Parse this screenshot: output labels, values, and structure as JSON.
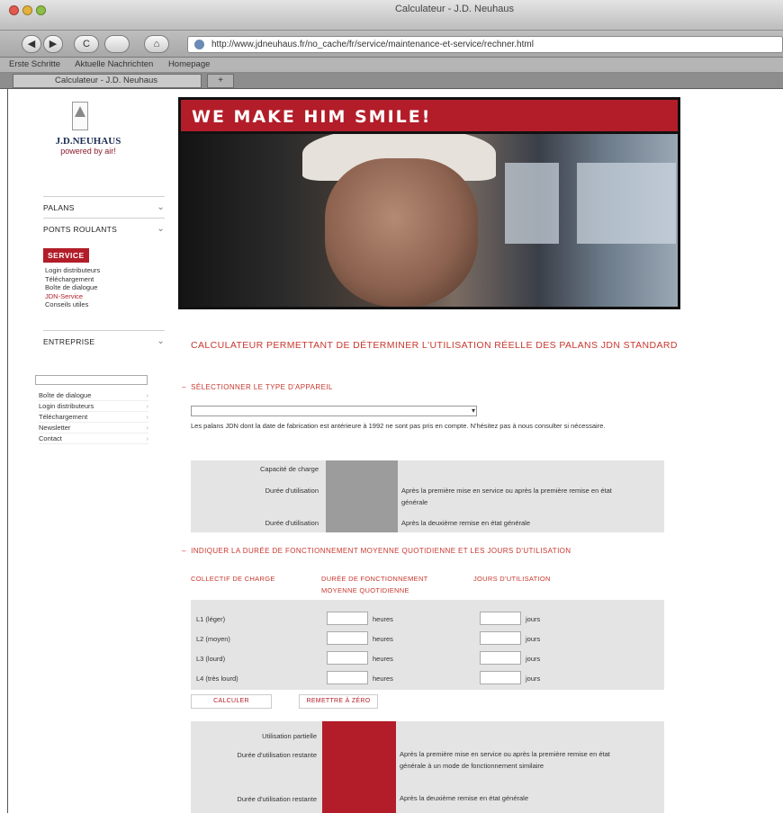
{
  "browser": {
    "window_title": "Calculateur - J.D. Neuhaus",
    "url": "http://www.jdneuhaus.fr/no_cache/fr/service/maintenance-et-service/rechner.html",
    "bookmarks": [
      "Erste Schritte",
      "Aktuelle Nachrichten",
      "Homepage"
    ],
    "tab_label": "Calculateur - J.D. Neuhaus",
    "tab_add": "+",
    "back": "◀",
    "forward": "▶",
    "reload": "C",
    "home": "⌂"
  },
  "logo": {
    "mark": "J D N",
    "name": "J.D.NEUHAUS",
    "tagline": "powered by air!"
  },
  "sidebar": {
    "sections": [
      {
        "label": "PALANS",
        "chev": "⌄"
      },
      {
        "label": "PONTS ROULANTS",
        "chev": "⌄"
      }
    ],
    "service_label": "SERVICE",
    "service_links": [
      "Login distributeurs",
      "Téléchargement",
      "Boîte de dialogue",
      "JDN-Service",
      "Conseils utiles"
    ],
    "enterprise": {
      "label": "ENTREPRISE",
      "chev": "⌄"
    },
    "quick_links": [
      "Boîte de dialogue",
      "Login distributeurs",
      "Téléchargement",
      "Newsletter",
      "Contact"
    ]
  },
  "hero": {
    "headline": "WE MAKE HIM SMILE!"
  },
  "content": {
    "title": "CALCULATEUR PERMETTANT DE DÉTERMINER L'UTILISATION RÉELLE DES PALANS JDN STANDARD",
    "section1_heading": "SÉLECTIONNER LE TYPE D'APPAREIL",
    "select_value": "",
    "note": "Les palans JDN dont la date de fabrication est antérieure à 1992 ne sont pas pris en compte. N'hésitez pas à nous consulter si nécessaire.",
    "panel1": {
      "labels": [
        "Capacité de charge",
        "Durée d'utilisation",
        "Durée d'utilisation"
      ],
      "texts": [
        "Après la première mise en service ou après la première remise en état générale",
        "Après la deuxième remise en état générale"
      ]
    },
    "section2_heading": "INDIQUER LA DURÉE DE FONCTIONNEMENT MOYENNE QUOTIDIENNE ET LES JOURS D'UTILISATION",
    "columns": [
      "COLLECTIF DE CHARGE",
      "DURÉE DE FONCTIONNEMENT MOYENNE QUOTIDIENNE",
      "JOURS D'UTILISATION"
    ],
    "rows": [
      "L1 (léger)",
      "L2 (moyen)",
      "L3 (lourd)",
      "L4 (très lourd)"
    ],
    "unit_hours": "heures",
    "unit_days": "jours",
    "calc_button": "CALCULER",
    "reset_button": "REMETTRE À ZÉRO",
    "panel2": {
      "labels": [
        "Utilisation partielle",
        "Durée d'utilisation restante",
        "Durée d'utilisation restante"
      ],
      "texts": [
        "Après la première mise en service ou après la première remise en état générale à un mode de fonctionnement similaire",
        "Après la deuxième remise en état générale"
      ]
    },
    "collapse_marker": "–"
  },
  "colors": {
    "brand_red": "#b21d29",
    "heading_red": "#c8372e"
  }
}
